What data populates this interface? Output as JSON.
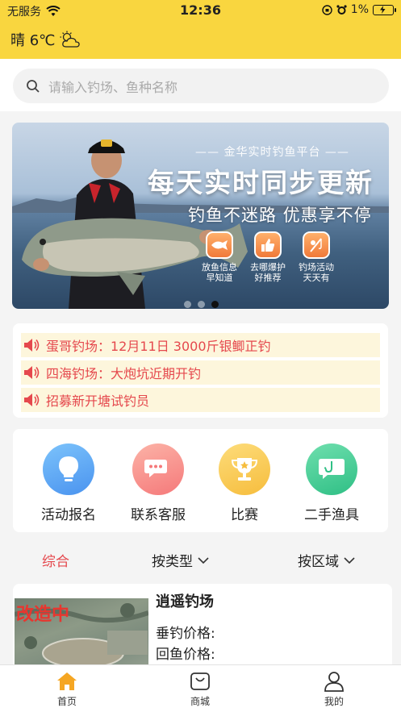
{
  "status_bar": {
    "carrier": "无服务",
    "time": "12:36",
    "battery": "1%"
  },
  "weather": {
    "text": "晴 6℃",
    "icon": "partly-cloudy-icon"
  },
  "search": {
    "placeholder": "请输入钓场、鱼种名称"
  },
  "banner": {
    "subtitle": "金华实时钓鱼平台",
    "title": "每天实时同步更新",
    "slogan": "钓鱼不迷路 优惠享不停",
    "features": [
      {
        "line1": "放鱼信息",
        "line2": "早知道",
        "icon": "fish-icon"
      },
      {
        "line1": "去哪爆护",
        "line2": "好推荐",
        "icon": "thumbs-up-icon"
      },
      {
        "line1": "钓场活动",
        "line2": "天天有",
        "icon": "fishing-icon"
      }
    ],
    "active_slide": 3,
    "slide_count": 3
  },
  "notices": [
    "蛋哥钓场：12月11日 3000斤银鲫正钓",
    "四海钓场：大炮坑近期开钓",
    "招募新开塘试钓员"
  ],
  "quick_menu": [
    {
      "label": "活动报名",
      "icon": "lightbulb-icon",
      "color": "#5aa8f5"
    },
    {
      "label": "联系客服",
      "icon": "chat-bubbles-icon",
      "color": "#f98a86"
    },
    {
      "label": "比赛",
      "icon": "trophy-icon",
      "color": "#f8c84e"
    },
    {
      "label": "二手渔具",
      "icon": "fishhook-icon",
      "color": "#3ec98e"
    }
  ],
  "filters": {
    "all": "综合",
    "by_type": "按类型",
    "by_area": "按区域"
  },
  "listing": {
    "name": "逍遥钓场",
    "thumb_overlay": "改造中",
    "price_label_1": "垂钓价格:",
    "price_label_2": "回鱼价格:"
  },
  "tabs": [
    {
      "label": "首页",
      "icon": "home-icon",
      "active": true
    },
    {
      "label": "商城",
      "icon": "shopping-bag-icon",
      "active": false
    },
    {
      "label": "我的",
      "icon": "user-icon",
      "active": false
    }
  ],
  "colors": {
    "header": "#f9d63f",
    "accent_red": "#e5484d",
    "tab_active": "#f5a623"
  }
}
